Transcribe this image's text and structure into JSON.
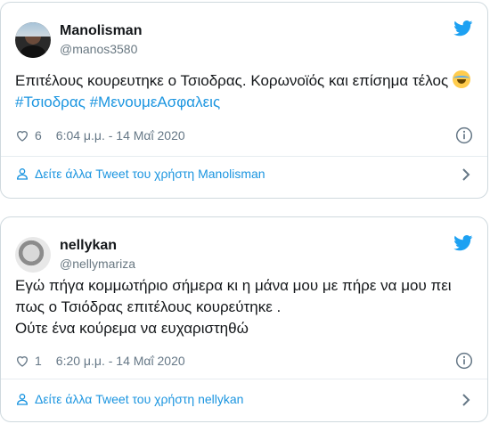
{
  "tweets": [
    {
      "display_name": "Manolisman",
      "handle": "@manos3580",
      "text_plain": "Επιτέλους κουρευτηκε ο Τσιοδρας. Κορωνοϊός και επίσημα τέλος",
      "hashtag1": "#Τσιοδρας",
      "hashtag2": "#ΜενουμεΑσφαλεις",
      "likes": "6",
      "time": "6:04 μ.μ. - 14 Μαΐ 2020",
      "more_link": "Δείτε άλλα Tweet του χρήστη Manolisman"
    },
    {
      "display_name": "nellykan",
      "handle": "@nellymariza",
      "line1": "Εγώ πήγα κομμωτήριο σήμερα κι η μάνα μου με πήρε να μου πει",
      "line2": "πως ο Τσιόδρας επιτέλους κουρεύτηκε .",
      "line3": "Ούτε ένα κούρεμα να ευχαριστηθώ",
      "likes": "1",
      "time": "6:20 μ.μ. - 14 Μαΐ 2020",
      "more_link": "Δείτε άλλα Tweet του χρήστη nellykan"
    }
  ],
  "icons": [
    "twitter-bird-icon",
    "heart-icon",
    "info-icon",
    "user-icon",
    "chevron-right-icon",
    "laughing-emoji-icon"
  ],
  "colors": {
    "link": "#1b95e0",
    "bird": "#1da1f2",
    "muted": "#657786",
    "border": "#cfd9de"
  }
}
